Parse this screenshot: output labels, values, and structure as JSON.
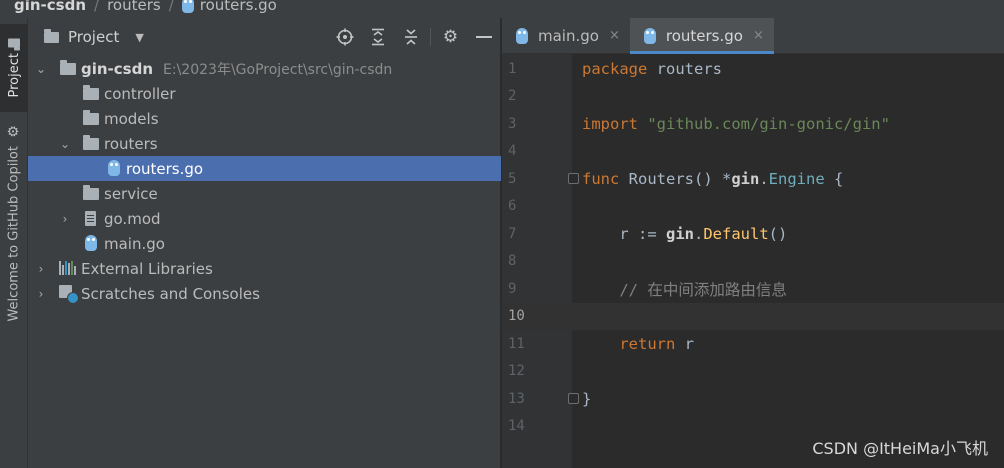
{
  "breadcrumb": {
    "root": "gin-csdn",
    "folder": "routers",
    "file": "routers.go"
  },
  "toolstrip": {
    "project_tab": "Project",
    "copilot_tab": "Welcome to GitHub Copilot"
  },
  "project_panel": {
    "title": "Project",
    "tools": [
      "locate-icon",
      "expand-all-icon",
      "collapse-all-icon",
      "gear-icon",
      "hide-icon"
    ],
    "tree": [
      {
        "label": "gin-csdn",
        "path": "E:\\2023年\\GoProject\\src\\gin-csdn",
        "type": "folder",
        "depth": 0,
        "expanded": true
      },
      {
        "label": "controller",
        "type": "folder",
        "depth": 1
      },
      {
        "label": "models",
        "type": "folder",
        "depth": 1
      },
      {
        "label": "routers",
        "type": "folder",
        "depth": 1,
        "expanded": true
      },
      {
        "label": "routers.go",
        "type": "go-file",
        "depth": 2,
        "selected": true
      },
      {
        "label": "service",
        "type": "folder",
        "depth": 1
      },
      {
        "label": "go.mod",
        "type": "mod-file",
        "depth": 1,
        "collapsed": true
      },
      {
        "label": "main.go",
        "type": "go-file",
        "depth": 1
      },
      {
        "label": "External Libraries",
        "type": "libraries",
        "depth": 0,
        "collapsed": true
      },
      {
        "label": "Scratches and Consoles",
        "type": "scratches",
        "depth": 0,
        "collapsed": true
      }
    ]
  },
  "editor": {
    "tabs": [
      {
        "label": "main.go",
        "active": false,
        "close": "×"
      },
      {
        "label": "routers.go",
        "active": true,
        "close": "×"
      }
    ],
    "current_line": 10,
    "lines": [
      {
        "n": "1",
        "tokens": [
          [
            "kw",
            "package"
          ],
          [
            "plain",
            " routers"
          ]
        ]
      },
      {
        "n": "2",
        "tokens": []
      },
      {
        "n": "3",
        "tokens": [
          [
            "kw",
            "import"
          ],
          [
            "plain",
            " "
          ],
          [
            "str",
            "\"github.com/gin-gonic/gin\""
          ]
        ]
      },
      {
        "n": "4",
        "tokens": []
      },
      {
        "n": "5",
        "tokens": [
          [
            "kw",
            "func"
          ],
          [
            "plain",
            " Routers() *"
          ],
          [
            "gin",
            "gin"
          ],
          [
            "plain",
            "."
          ],
          [
            "cls",
            "Engine"
          ],
          [
            "plain",
            " {"
          ]
        ],
        "fold": true
      },
      {
        "n": "6",
        "tokens": []
      },
      {
        "n": "7",
        "tokens": [
          [
            "plain",
            "    r := "
          ],
          [
            "gin",
            "gin"
          ],
          [
            "plain",
            "."
          ],
          [
            "fn",
            "Default"
          ],
          [
            "plain",
            "()"
          ]
        ]
      },
      {
        "n": "8",
        "tokens": []
      },
      {
        "n": "9",
        "tokens": [
          [
            "cmt",
            "    // 在中间添加路由信息"
          ]
        ]
      },
      {
        "n": "10",
        "tokens": []
      },
      {
        "n": "11",
        "tokens": [
          [
            "plain",
            "    "
          ],
          [
            "kw",
            "return"
          ],
          [
            "plain",
            " r"
          ]
        ]
      },
      {
        "n": "12",
        "tokens": []
      },
      {
        "n": "13",
        "tokens": [
          [
            "plain",
            "}"
          ]
        ],
        "fold": true
      },
      {
        "n": "14",
        "tokens": []
      }
    ]
  },
  "watermark": "CSDN @ItHeiMa小飞机"
}
